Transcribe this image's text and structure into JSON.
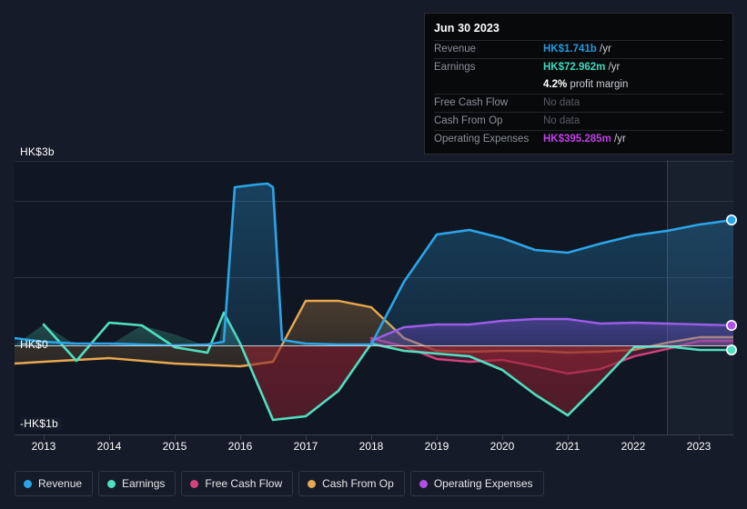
{
  "axis": {
    "y_labels": [
      {
        "text": "HK$3b",
        "y": 160
      },
      {
        "text": "HK$0",
        "y": 372
      },
      {
        "text": "-HK$1b",
        "y": 459
      }
    ],
    "x_labels": [
      "2013",
      "2014",
      "2015",
      "2016",
      "2017",
      "2018",
      "2019",
      "2020",
      "2021",
      "2022",
      "2023"
    ]
  },
  "tooltip": {
    "date": "Jun 30 2023",
    "rows": [
      {
        "name": "Revenue",
        "amount": "HK$1.741b",
        "unit": "/yr",
        "color_class": "revenue",
        "nodata": false
      },
      {
        "name": "Earnings",
        "amount": "HK$72.962m",
        "unit": "/yr",
        "color_class": "earnings",
        "nodata": false
      },
      {
        "name": "",
        "amount": "4.2%",
        "unit": "profit margin",
        "color_class": "margin",
        "nodata": false,
        "is_margin": true
      },
      {
        "name": "Free Cash Flow",
        "amount": "No data",
        "unit": "",
        "color_class": "",
        "nodata": true
      },
      {
        "name": "Cash From Op",
        "amount": "No data",
        "unit": "",
        "color_class": "",
        "nodata": true
      },
      {
        "name": "Operating Expenses",
        "amount": "HK$395.285m",
        "unit": "/yr",
        "color_class": "opex",
        "nodata": false
      }
    ]
  },
  "legend": [
    {
      "label": "Revenue",
      "color": "#2ba5e8"
    },
    {
      "label": "Earnings",
      "color": "#4fe0c0"
    },
    {
      "label": "Free Cash Flow",
      "color": "#d6427e"
    },
    {
      "label": "Cash From Op",
      "color": "#e8a84e"
    },
    {
      "label": "Operating Expenses",
      "color": "#b24fe8"
    }
  ],
  "chart_data": {
    "type": "area",
    "title": "",
    "xlabel": "",
    "ylabel": "HK$",
    "currency": "HKD",
    "grid": true,
    "legend_position": "bottom",
    "ylim": [
      -1.2,
      3.0
    ],
    "y_ticks": [
      3,
      0,
      -1
    ],
    "y_tick_labels": [
      "HK$3b",
      "HK$0",
      "-HK$1b"
    ],
    "x": [
      2013,
      2014,
      2015,
      2016,
      2017,
      2018,
      2019,
      2020,
      2021,
      2022,
      2023
    ],
    "categories": [
      "2013",
      "2014",
      "2015",
      "2016",
      "2017",
      "2018",
      "2019",
      "2020",
      "2021",
      "2022",
      "2023"
    ],
    "forecast_start": 2022.45,
    "series": [
      {
        "name": "Revenue",
        "color": "#2ba5e8",
        "values": [
          0.09,
          0.03,
          0.02,
          2.62,
          0.02,
          0.01,
          1.1,
          1.66,
          1.55,
          1.64,
          1.741
        ],
        "end_label": "HK$1.741b"
      },
      {
        "name": "Earnings",
        "color": "#4fe0c0",
        "values": [
          0.18,
          -0.04,
          0.28,
          -0.97,
          -0.72,
          0.02,
          -0.06,
          -0.55,
          -0.9,
          -0.09,
          0.073
        ],
        "end_label": "HK$72.962m"
      },
      {
        "name": "Free Cash Flow",
        "color": "#d6427e",
        "values": [
          null,
          null,
          null,
          null,
          null,
          0.03,
          -0.14,
          -0.21,
          -0.32,
          -0.07,
          null
        ],
        "end_label": "No data"
      },
      {
        "name": "Cash From Op",
        "color": "#e8a84e",
        "values": [
          -0.12,
          -0.1,
          -0.16,
          -0.14,
          0.68,
          0.6,
          -0.05,
          -0.08,
          -0.09,
          -0.04,
          null
        ],
        "end_label": "No data"
      },
      {
        "name": "Operating Expenses",
        "color": "#b24fe8",
        "values": [
          null,
          null,
          null,
          null,
          null,
          0.21,
          0.33,
          0.36,
          0.38,
          0.34,
          0.395
        ],
        "end_label": "HK$395.285m"
      }
    ]
  }
}
